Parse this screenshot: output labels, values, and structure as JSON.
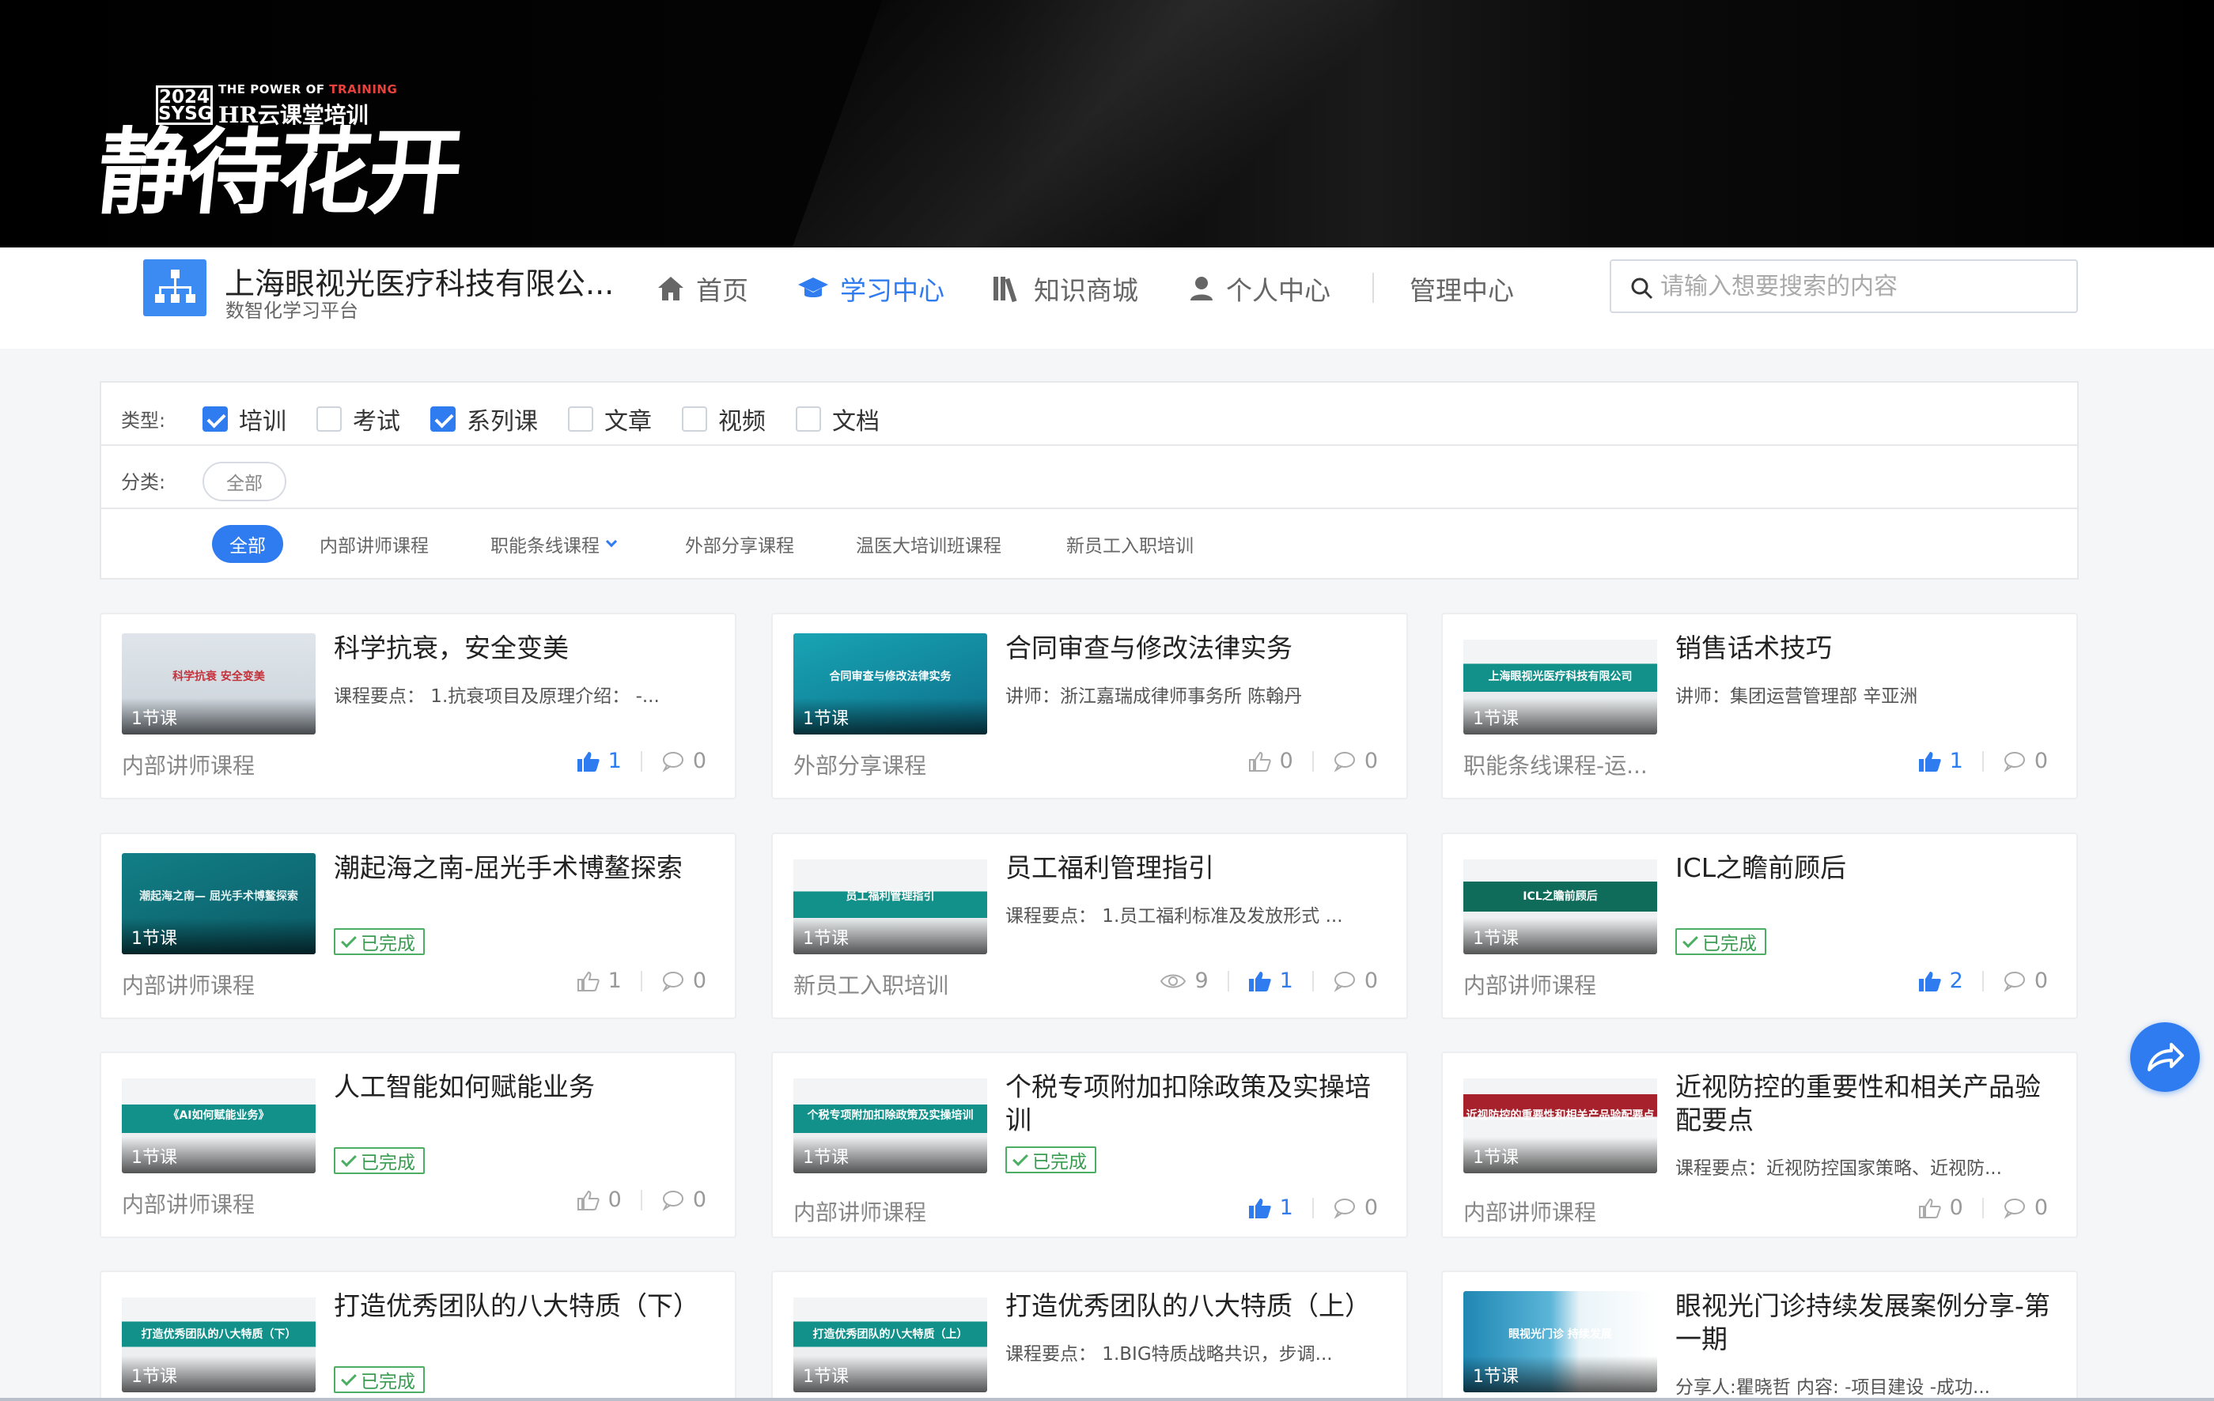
{
  "banner": {
    "year_top": "2024",
    "year_bottom": "SYSG",
    "power_prefix": "THE POWER OF",
    "power_suffix": "TRAINING",
    "event": "HR云课堂培训",
    "slogan": "静待花开"
  },
  "header": {
    "org_name": "上海眼视光医疗科技有限公...",
    "org_sub": "数智化学习平台",
    "nav": [
      {
        "label": "首页",
        "icon": "home-icon"
      },
      {
        "label": "学习中心",
        "icon": "graduation-cap-icon",
        "active": true
      },
      {
        "label": "知识商城",
        "icon": "books-icon"
      },
      {
        "label": "个人中心",
        "icon": "user-icon"
      },
      {
        "label": "管理中心"
      }
    ],
    "search_placeholder": "请输入想要搜索的内容"
  },
  "filter": {
    "type_label": "类型:",
    "types": [
      {
        "label": "培训",
        "checked": true
      },
      {
        "label": "考试",
        "checked": false
      },
      {
        "label": "系列课",
        "checked": true
      },
      {
        "label": "文章",
        "checked": false
      },
      {
        "label": "视频",
        "checked": false
      },
      {
        "label": "文档",
        "checked": false
      }
    ],
    "category_label": "分类:",
    "category_all": "全部",
    "subcategories": [
      "全部",
      "内部讲师课程",
      "职能条线课程",
      "外部分享课程",
      "温医大培训班课程",
      "新员工入职培训"
    ]
  },
  "colors": {
    "primary": "#2f7bf0",
    "teal": "#11908d",
    "done_green": "#4cae62"
  },
  "cards": [
    {
      "title": "科学抗衰，安全变美",
      "desc": "课程要点： 1.抗衰项目及原理介绍： -...",
      "lessons": "1节课",
      "category": "内部讲师课程",
      "likes": "1",
      "liked": true,
      "comments": "0",
      "thumb_text": "科学抗衰 安全变美"
    },
    {
      "title": "合同审查与修改法律实务",
      "desc": "讲师：浙江嘉瑞成律师事务所 陈翰丹",
      "lessons": "1节课",
      "category": "外部分享课程",
      "likes": "0",
      "liked": false,
      "comments": "0",
      "thumb_text": "合同审查与修改法律实务"
    },
    {
      "title": "销售话术技巧",
      "desc": "讲师：集团运营管理部 辛亚洲",
      "lessons": "1节课",
      "category": "职能条线课程-运...",
      "likes": "1",
      "liked": true,
      "comments": "0",
      "thumb_text": "上海眼视光医疗科技有限公司"
    },
    {
      "title": "潮起海之南-屈光手术博鳌探索",
      "done": "已完成",
      "lessons": "1节课",
      "category": "内部讲师课程",
      "likes": "1",
      "liked": false,
      "comments": "0",
      "thumb_text": "潮起海之南— 屈光手术博鳌探索"
    },
    {
      "title": "员工福利管理指引",
      "desc": "课程要点： 1.员工福利标准及发放形式 ...",
      "lessons": "1节课",
      "category": "新员工入职培训",
      "views": "9",
      "likes": "1",
      "liked": true,
      "comments": "0",
      "thumb_text": "员工福利管理指引"
    },
    {
      "title": "ICL之瞻前顾后",
      "done": "已完成",
      "lessons": "1节课",
      "category": "内部讲师课程",
      "likes": "2",
      "liked": true,
      "comments": "0",
      "thumb_text": "ICL之瞻前顾后"
    },
    {
      "title": "人工智能如何赋能业务",
      "done": "已完成",
      "lessons": "1节课",
      "category": "内部讲师课程",
      "likes": "0",
      "liked": false,
      "comments": "0",
      "thumb_text": "《AI如何赋能业务》"
    },
    {
      "title": "个税专项附加扣除政策及实操培训",
      "done": "已完成",
      "lessons": "1节课",
      "category": "内部讲师课程",
      "likes": "1",
      "liked": true,
      "comments": "0",
      "thumb_text": "个税专项附加扣除政策及实操培训"
    },
    {
      "title": "近视防控的重要性和相关产品验配要点",
      "desc": "课程要点：近视防控国家策略、近视防...",
      "lessons": "1节课",
      "category": "内部讲师课程",
      "likes": "0",
      "liked": false,
      "comments": "0",
      "thumb_text": "近视防控的重要性和相关产品验配要点"
    },
    {
      "title": "打造优秀团队的八大特质（下）",
      "done": "已完成",
      "lessons": "1节课",
      "thumb_text": "打造优秀团队的八大特质（下）"
    },
    {
      "title": "打造优秀团队的八大特质（上）",
      "desc": "课程要点： 1.BIG特质战略共识，步调...",
      "lessons": "1节课",
      "thumb_text": "打造优秀团队的八大特质（上）"
    },
    {
      "title": "眼视光门诊持续发展案例分享-第一期",
      "desc": "分享人:瞿晓哲 内容: -项目建设 -成功...",
      "lessons": "1节课",
      "thumb_text": "眼视光门诊 持续发展"
    }
  ]
}
